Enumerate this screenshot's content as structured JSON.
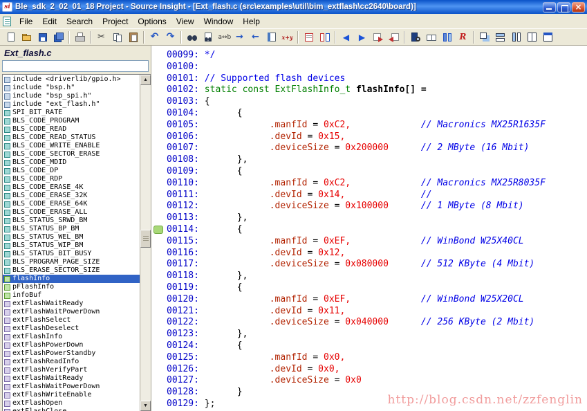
{
  "window": {
    "title": "Ble_sdk_2_02_01_18 Project - Source Insight - [Ext_flash.c (src\\examples\\util\\bim_extflash\\cc2640\\board)]",
    "controls": [
      "minimize",
      "restore",
      "close"
    ]
  },
  "menu": {
    "items": [
      "File",
      "Edit",
      "Search",
      "Project",
      "Options",
      "View",
      "Window",
      "Help"
    ]
  },
  "toolbar": {
    "groups": [
      [
        "new-file",
        "open-file",
        "save-file",
        "save-all"
      ],
      [
        "print-file"
      ],
      [
        "cut",
        "copy",
        "paste"
      ],
      [
        "undo",
        "redo"
      ],
      [
        "find",
        "find-in-files",
        "replace",
        "search-forward",
        "search-backward",
        "keyword-list",
        "calc-expression"
      ],
      [
        "draft-view",
        "compare-files"
      ],
      [
        "go-back",
        "go-forward",
        "goto-definition",
        "goto-reference"
      ],
      [
        "browse-project-symbols",
        "browse-files",
        "symbol-window",
        "relation-window"
      ],
      [
        "window-cascade",
        "window-tile-horizontal",
        "window-tile-vertical",
        "window-split",
        "window-activate"
      ]
    ]
  },
  "sidebar": {
    "title": "Ext_flash.c",
    "filter": {
      "value": "",
      "placeholder": ""
    },
    "items": [
      {
        "label": "include <driverlib/gpio.h>",
        "kind": "include",
        "selected": false
      },
      {
        "label": "include \"bsp.h\"",
        "kind": "include",
        "selected": false
      },
      {
        "label": "include \"bsp_spi.h\"",
        "kind": "include",
        "selected": false
      },
      {
        "label": "include \"ext_flash.h\"",
        "kind": "include",
        "selected": false
      },
      {
        "label": "SPI_BIT_RATE",
        "kind": "define",
        "selected": false
      },
      {
        "label": "BLS_CODE_PROGRAM",
        "kind": "define",
        "selected": false
      },
      {
        "label": "BLS_CODE_READ",
        "kind": "define",
        "selected": false
      },
      {
        "label": "BLS_CODE_READ_STATUS",
        "kind": "define",
        "selected": false
      },
      {
        "label": "BLS_CODE_WRITE_ENABLE",
        "kind": "define",
        "selected": false
      },
      {
        "label": "BLS_CODE_SECTOR_ERASE",
        "kind": "define",
        "selected": false
      },
      {
        "label": "BLS_CODE_MDID",
        "kind": "define",
        "selected": false
      },
      {
        "label": "BLS_CODE_DP",
        "kind": "define",
        "selected": false
      },
      {
        "label": "BLS_CODE_RDP",
        "kind": "define",
        "selected": false
      },
      {
        "label": "BLS_CODE_ERASE_4K",
        "kind": "define",
        "selected": false
      },
      {
        "label": "BLS_CODE_ERASE_32K",
        "kind": "define",
        "selected": false
      },
      {
        "label": "BLS_CODE_ERASE_64K",
        "kind": "define",
        "selected": false
      },
      {
        "label": "BLS_CODE_ERASE_ALL",
        "kind": "define",
        "selected": false
      },
      {
        "label": "BLS_STATUS_SRWD_BM",
        "kind": "define",
        "selected": false
      },
      {
        "label": "BLS_STATUS_BP_BM",
        "kind": "define",
        "selected": false
      },
      {
        "label": "BLS_STATUS_WEL_BM",
        "kind": "define",
        "selected": false
      },
      {
        "label": "BLS_STATUS_WIP_BM",
        "kind": "define",
        "selected": false
      },
      {
        "label": "BLS_STATUS_BIT_BUSY",
        "kind": "define",
        "selected": false
      },
      {
        "label": "BLS_PROGRAM_PAGE_SIZE",
        "kind": "define",
        "selected": false
      },
      {
        "label": "BLS_ERASE_SECTOR_SIZE",
        "kind": "define",
        "selected": false
      },
      {
        "label": "flashInfo",
        "kind": "variable",
        "selected": true
      },
      {
        "label": "pFlashInfo",
        "kind": "variable",
        "selected": false
      },
      {
        "label": "infoBuf",
        "kind": "variable",
        "selected": false
      },
      {
        "label": "extFlashWaitReady",
        "kind": "function",
        "selected": false
      },
      {
        "label": "extFlashWaitPowerDown",
        "kind": "function",
        "selected": false
      },
      {
        "label": "extFlashSelect",
        "kind": "function",
        "selected": false
      },
      {
        "label": "extFlashDeselect",
        "kind": "function",
        "selected": false
      },
      {
        "label": "extFlashInfo",
        "kind": "function",
        "selected": false
      },
      {
        "label": "extFlashPowerDown",
        "kind": "function",
        "selected": false
      },
      {
        "label": "extFlashPowerStandby",
        "kind": "function",
        "selected": false
      },
      {
        "label": "extFlashReadInfo",
        "kind": "function",
        "selected": false
      },
      {
        "label": "extFlashVerifyPart",
        "kind": "function",
        "selected": false
      },
      {
        "label": "extFlashWaitReady",
        "kind": "function",
        "selected": false
      },
      {
        "label": "extFlashWaitPowerDown",
        "kind": "function",
        "selected": false
      },
      {
        "label": "extFlashWriteEnable",
        "kind": "function",
        "selected": false
      },
      {
        "label": "extFlashOpen",
        "kind": "function",
        "selected": false
      },
      {
        "label": "extFlashClose",
        "kind": "function",
        "selected": false
      }
    ]
  },
  "editor": {
    "lines": [
      {
        "num": "00099:",
        "seg": [
          {
            "s": "c",
            "t": "*/"
          }
        ]
      },
      {
        "num": "00100:",
        "seg": []
      },
      {
        "num": "00101:",
        "seg": [
          {
            "s": "c",
            "t": "// Supported flash devices"
          }
        ]
      },
      {
        "num": "00102:",
        "seg": [
          {
            "s": "k",
            "t": "static const ExtFlashInfo_t "
          },
          {
            "s": "d",
            "t": "flashInfo[] ="
          }
        ]
      },
      {
        "num": "00103:",
        "seg": [
          {
            "s": "p",
            "t": "{"
          }
        ]
      },
      {
        "num": "00104:",
        "seg": [
          {
            "s": "p",
            "t": "      {"
          }
        ]
      },
      {
        "num": "00105:",
        "seg": [
          {
            "s": "m",
            "t": "            .manfId"
          },
          {
            "s": "p",
            "t": " = "
          },
          {
            "s": "v",
            "t": "0xC2,"
          },
          {
            "s": "p",
            "t": "             "
          },
          {
            "s": "ci",
            "t": "// Macronics MX25R1635F"
          }
        ]
      },
      {
        "num": "00106:",
        "seg": [
          {
            "s": "m",
            "t": "            .devId"
          },
          {
            "s": "p",
            "t": " = "
          },
          {
            "s": "v",
            "t": "0x15,"
          }
        ]
      },
      {
        "num": "00107:",
        "seg": [
          {
            "s": "m",
            "t": "            .deviceSize"
          },
          {
            "s": "p",
            "t": " = "
          },
          {
            "s": "v",
            "t": "0x200000"
          },
          {
            "s": "p",
            "t": "      "
          },
          {
            "s": "ci",
            "t": "// 2 MByte (16 Mbit)"
          }
        ]
      },
      {
        "num": "00108:",
        "seg": [
          {
            "s": "p",
            "t": "      },"
          }
        ]
      },
      {
        "num": "00109:",
        "seg": [
          {
            "s": "p",
            "t": "      {"
          }
        ]
      },
      {
        "num": "00110:",
        "seg": [
          {
            "s": "m",
            "t": "            .manfId"
          },
          {
            "s": "p",
            "t": " = "
          },
          {
            "s": "v",
            "t": "0xC2,"
          },
          {
            "s": "p",
            "t": "             "
          },
          {
            "s": "ci",
            "t": "// Macronics MX25R8035F"
          }
        ]
      },
      {
        "num": "00111:",
        "seg": [
          {
            "s": "m",
            "t": "            .devId"
          },
          {
            "s": "p",
            "t": " = "
          },
          {
            "s": "v",
            "t": "0x14,"
          },
          {
            "s": "p",
            "t": "              "
          },
          {
            "s": "ci",
            "t": "//"
          }
        ]
      },
      {
        "num": "00112:",
        "seg": [
          {
            "s": "m",
            "t": "            .deviceSize"
          },
          {
            "s": "p",
            "t": " = "
          },
          {
            "s": "v",
            "t": "0x100000"
          },
          {
            "s": "p",
            "t": "      "
          },
          {
            "s": "ci",
            "t": "// 1 MByte (8 Mbit)"
          }
        ]
      },
      {
        "num": "00113:",
        "seg": [
          {
            "s": "p",
            "t": "      },"
          }
        ]
      },
      {
        "num": "00114:",
        "mark": true,
        "seg": [
          {
            "s": "p",
            "t": "      {"
          }
        ]
      },
      {
        "num": "00115:",
        "seg": [
          {
            "s": "m",
            "t": "            .manfId"
          },
          {
            "s": "p",
            "t": " = "
          },
          {
            "s": "v",
            "t": "0xEF,"
          },
          {
            "s": "p",
            "t": "             "
          },
          {
            "s": "ci",
            "t": "// WinBond W25X40CL"
          }
        ]
      },
      {
        "num": "00116:",
        "seg": [
          {
            "s": "m",
            "t": "            .devId"
          },
          {
            "s": "p",
            "t": " = "
          },
          {
            "s": "v",
            "t": "0x12,"
          }
        ]
      },
      {
        "num": "00117:",
        "seg": [
          {
            "s": "m",
            "t": "            .deviceSize"
          },
          {
            "s": "p",
            "t": " = "
          },
          {
            "s": "v",
            "t": "0x080000"
          },
          {
            "s": "p",
            "t": "      "
          },
          {
            "s": "ci",
            "t": "// 512 KByte (4 Mbit)"
          }
        ]
      },
      {
        "num": "00118:",
        "seg": [
          {
            "s": "p",
            "t": "      },"
          }
        ]
      },
      {
        "num": "00119:",
        "seg": [
          {
            "s": "p",
            "t": "      {"
          }
        ]
      },
      {
        "num": "00120:",
        "seg": [
          {
            "s": "m",
            "t": "            .manfId"
          },
          {
            "s": "p",
            "t": " = "
          },
          {
            "s": "v",
            "t": "0xEF,"
          },
          {
            "s": "p",
            "t": "             "
          },
          {
            "s": "ci",
            "t": "// WinBond W25X20CL"
          }
        ]
      },
      {
        "num": "00121:",
        "seg": [
          {
            "s": "m",
            "t": "            .devId"
          },
          {
            "s": "p",
            "t": " = "
          },
          {
            "s": "v",
            "t": "0x11,"
          }
        ]
      },
      {
        "num": "00122:",
        "seg": [
          {
            "s": "m",
            "t": "            .deviceSize"
          },
          {
            "s": "p",
            "t": " = "
          },
          {
            "s": "v",
            "t": "0x040000"
          },
          {
            "s": "p",
            "t": "      "
          },
          {
            "s": "ci",
            "t": "// 256 KByte (2 Mbit)"
          }
        ]
      },
      {
        "num": "00123:",
        "seg": [
          {
            "s": "p",
            "t": "      },"
          }
        ]
      },
      {
        "num": "00124:",
        "seg": [
          {
            "s": "p",
            "t": "      {"
          }
        ]
      },
      {
        "num": "00125:",
        "seg": [
          {
            "s": "m",
            "t": "            .manfId"
          },
          {
            "s": "p",
            "t": " = "
          },
          {
            "s": "v",
            "t": "0x0,"
          }
        ]
      },
      {
        "num": "00126:",
        "seg": [
          {
            "s": "m",
            "t": "            .devId"
          },
          {
            "s": "p",
            "t": " = "
          },
          {
            "s": "v",
            "t": "0x0,"
          }
        ]
      },
      {
        "num": "00127:",
        "seg": [
          {
            "s": "m",
            "t": "            .deviceSize"
          },
          {
            "s": "p",
            "t": " = "
          },
          {
            "s": "v",
            "t": "0x0"
          }
        ]
      },
      {
        "num": "00128:",
        "seg": [
          {
            "s": "p",
            "t": "      }"
          }
        ]
      },
      {
        "num": "00129:",
        "seg": [
          {
            "s": "p",
            "t": "};"
          }
        ]
      }
    ]
  },
  "watermark": {
    "text": "http://blog.csdn.net/zzfenglin"
  },
  "colors": {
    "title-grad-1": "#0a52c8",
    "title-grad-2": "#4e94f2",
    "chrome-bg": "#ece9d8",
    "selection": "#3163c5",
    "comment": "#0000e6",
    "keyword": "#007f00",
    "member": "#b22200",
    "value": "#e60000",
    "linenum": "#0000c8",
    "watermark": "#ef8b8b",
    "bookmark-green": "#a8d878"
  }
}
